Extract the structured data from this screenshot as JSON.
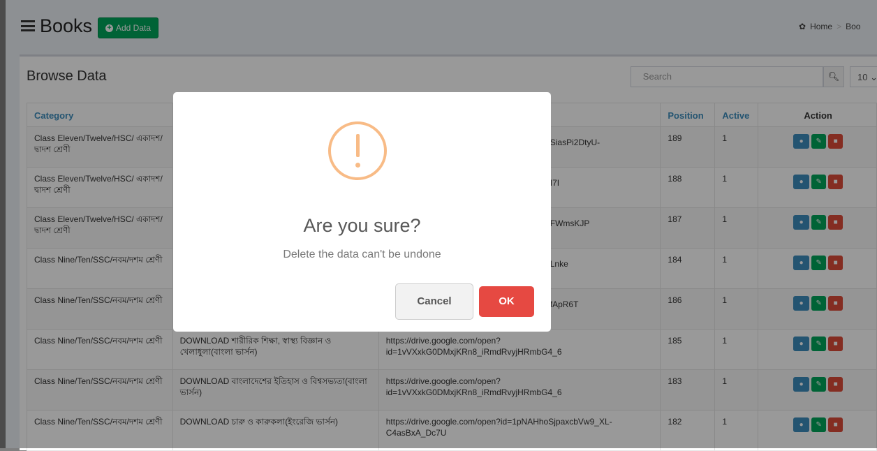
{
  "header": {
    "title": "Books",
    "add_button": "Add Data",
    "breadcrumb": [
      "Home",
      "Boo"
    ]
  },
  "box": {
    "title": "Browse Data",
    "search_placeholder": "Search",
    "page_size": "10"
  },
  "table": {
    "headers": [
      "Category",
      "",
      "",
      "Position",
      "Active",
      "Action"
    ],
    "rows": [
      {
        "category": "Class Eleven/Twelve/HSC/ একাদশ/দ্বাদশ শ্রেণী",
        "name": "",
        "link": "SiasPi2DtyU-",
        "position": "189",
        "active": "1"
      },
      {
        "category": "Class Eleven/Twelve/HSC/ একাদশ/দ্বাদশ শ্রেণী",
        "name": "",
        "link": "I7I",
        "position": "188",
        "active": "1"
      },
      {
        "category": "Class Eleven/Twelve/HSC/ একাদশ/দ্বাদশ শ্রেণী",
        "name": "",
        "link": "FWmsKJP",
        "position": "187",
        "active": "1"
      },
      {
        "category": "Class Nine/Ten/SSC/নবম/দশম শ্রেণী",
        "name": "",
        "link": "Lnke",
        "position": "184",
        "active": "1"
      },
      {
        "category": "Class Nine/Ten/SSC/নবম/দশম শ্রেণী",
        "name": "",
        "link": "fApR6T",
        "position": "186",
        "active": "1"
      },
      {
        "category": "Class Nine/Ten/SSC/নবম/দশম শ্রেণী",
        "name": "DOWNLOAD শারীরিক শিক্ষা, স্বাস্থ্য বিজ্ঞান ও খেলাধুলা(বাংলা ভার্সন)",
        "link": "https://drive.google.com/open? id=1vVXxkG0DMxjKRn8_iRmdRvyjHRmbG4_6",
        "position": "185",
        "active": "1"
      },
      {
        "category": "Class Nine/Ten/SSC/নবম/দশম শ্রেণী",
        "name": "DOWNLOAD বাংলাদেশের ইতিহাস ও বিশ্বসভ্যতা(বাংলা ভার্সন)",
        "link": "https://drive.google.com/open? id=1vVXxkG0DMxjKRn8_iRmdRvyjHRmbG4_6",
        "position": "183",
        "active": "1"
      },
      {
        "category": "Class Nine/Ten/SSC/নবম/দশম শ্রেণী",
        "name": "DOWNLOAD চারু ও কারুকলা(ইংরেজি ভার্সন)",
        "link": "https://drive.google.com/open?id=1pNAHhoSjpaxcbVw9_XL- C4asBxA_Dc7U",
        "position": "182",
        "active": "1"
      }
    ]
  },
  "modal": {
    "title": "Are you sure?",
    "text": "Delete the data can't be undone",
    "cancel": "Cancel",
    "ok": "OK"
  },
  "colors": {
    "add": "#00a65a",
    "view": "#3c8dbc",
    "delete": "#dd4b39",
    "ok": "#e64942",
    "warning": "#f8bb86"
  }
}
